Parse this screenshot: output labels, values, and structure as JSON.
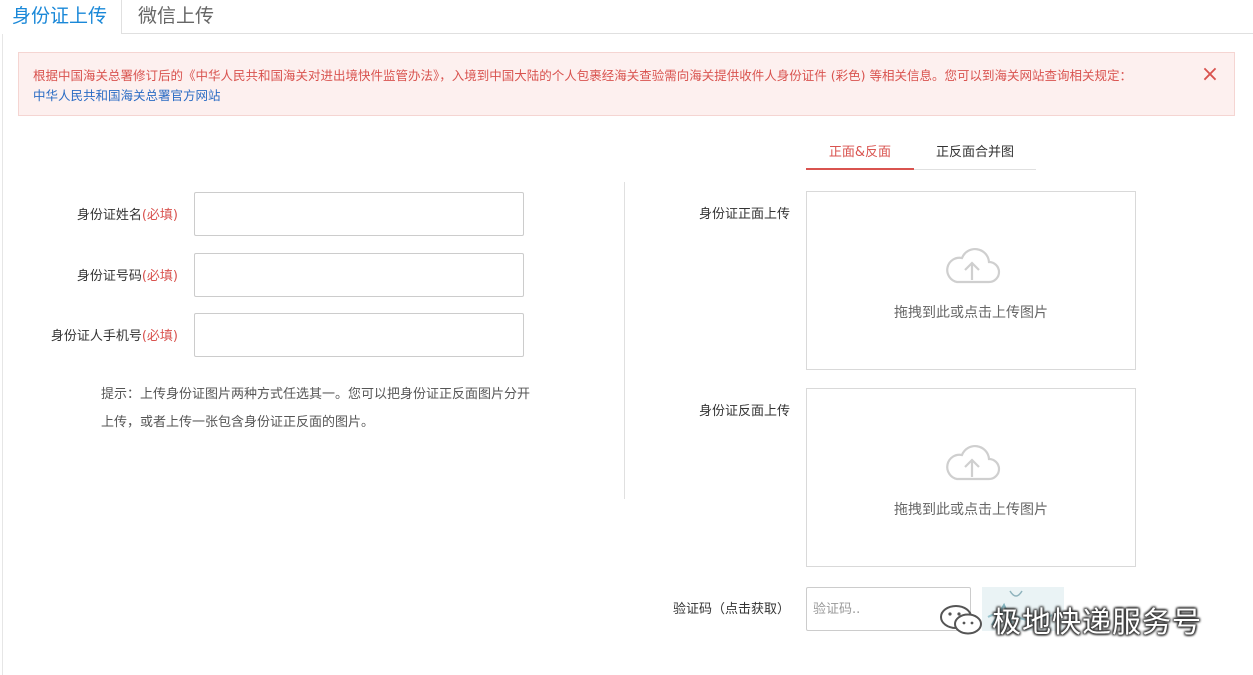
{
  "tabs": {
    "id_upload": "身份证上传",
    "wechat_upload": "微信上传"
  },
  "notice": {
    "text": "根据中国海关总署修订后的《中华人民共和国海关对进出境快件监管办法》，入境到中国大陆的个人包裹经海关查验需向海关提供收件人身份证件 (彩色) 等相关信息。您可以到海关网站查询相关规定：",
    "link": "中华人民共和国海关总署官方网站",
    "close": "×"
  },
  "upload_mode": {
    "front_back": "正面&反面",
    "merged": "正反面合并图"
  },
  "form": {
    "required": "(必填)",
    "name_label": "身份证姓名",
    "id_label": "身份证号码",
    "phone_label": "身份证人手机号",
    "name_value": "",
    "id_value": "",
    "phone_value": "",
    "tip_line1": "提示：上传身份证图片两种方式任选其一。您可以把身份证正反面图片分开",
    "tip_line2": "上传，或者上传一张包含身份证正反面的图片。"
  },
  "upload": {
    "front_label": "身份证正面上传",
    "back_label": "身份证反面上传",
    "hint": "拖拽到此或点击上传图片",
    "icon": "cloud-upload-icon"
  },
  "captcha": {
    "label": "验证码（点击获取）",
    "placeholder": "验证码.."
  },
  "watermark": {
    "text": "极地快递服务号",
    "icon": "wechat-icon"
  },
  "colors": {
    "accent_blue": "#1a88d8",
    "alert_red": "#d9534f",
    "notice_bg": "#fdf0ef",
    "link_blue": "#2b6cc4"
  }
}
